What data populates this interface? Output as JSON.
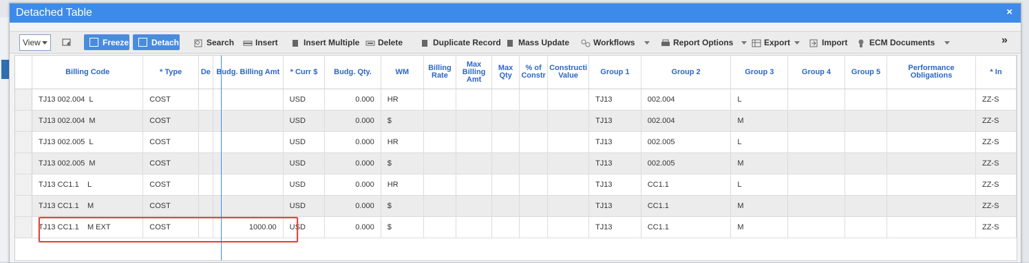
{
  "window": {
    "title": "Detached Table",
    "close_glyph": "×"
  },
  "toolbar": {
    "view_label": "View",
    "freeze_label": "Freeze",
    "detach_label": "Detach",
    "search_label": "Search",
    "insert_label": "Insert",
    "insert_multiple_label": "Insert Multiple",
    "delete_label": "Delete",
    "duplicate_label": "Duplicate Record",
    "mass_update_label": "Mass Update",
    "workflows_label": "Workflows",
    "report_options_label": "Report Options",
    "export_label": "Export",
    "import_label": "Import",
    "ecm_label": "ECM Documents",
    "more_glyph": "»"
  },
  "table": {
    "columns": [
      "Billing Code",
      "* Type",
      "De",
      "Budg. Billing Amt",
      "* Curr $",
      "Budg. Qty.",
      "WM",
      "Billing Rate",
      "Max Billing Amt",
      "Max Qty",
      "% of Constr",
      "Constructi Value",
      "Group 1",
      "Group 2",
      "Group 3",
      "Group 4",
      "Group 5",
      "Performance Obligations",
      "* In"
    ],
    "rows": [
      {
        "billing_code": "TJ13 002.004  L",
        "type": "COST",
        "amt": "",
        "curr": "USD",
        "qty": "0.000",
        "wm": "HR",
        "g1": "TJ13",
        "g2": "002.004",
        "g3": "L",
        "in": "ZZ-S"
      },
      {
        "billing_code": "TJ13 002.004  M",
        "type": "COST",
        "amt": "",
        "curr": "USD",
        "qty": "0.000",
        "wm": "$",
        "g1": "TJ13",
        "g2": "002.004",
        "g3": "M",
        "in": "ZZ-S"
      },
      {
        "billing_code": "TJ13 002.005  L",
        "type": "COST",
        "amt": "",
        "curr": "USD",
        "qty": "0.000",
        "wm": "HR",
        "g1": "TJ13",
        "g2": "002.005",
        "g3": "L",
        "in": "ZZ-S"
      },
      {
        "billing_code": "TJ13 002.005  M",
        "type": "COST",
        "amt": "",
        "curr": "USD",
        "qty": "0.000",
        "wm": "$",
        "g1": "TJ13",
        "g2": "002.005",
        "g3": "M",
        "in": "ZZ-S"
      },
      {
        "billing_code": "TJ13 CC1.1    L",
        "type": "COST",
        "amt": "",
        "curr": "USD",
        "qty": "0.000",
        "wm": "HR",
        "g1": "TJ13",
        "g2": "CC1.1",
        "g3": "L",
        "in": "ZZ-S"
      },
      {
        "billing_code": "TJ13 CC1.1    M",
        "type": "COST",
        "amt": "",
        "curr": "USD",
        "qty": "0.000",
        "wm": "$",
        "g1": "TJ13",
        "g2": "CC1.1",
        "g3": "M",
        "in": "ZZ-S"
      },
      {
        "billing_code": "TJ13 CC1.1    M EXT",
        "type": "COST",
        "amt": "1000.00",
        "curr": "USD",
        "qty": "0.000",
        "wm": "$",
        "g1": "TJ13",
        "g2": "CC1.1",
        "g3": "M",
        "in": "ZZ-S"
      }
    ]
  },
  "colors": {
    "titlebar": "#3d8be8",
    "header_text": "#2c66c4",
    "highlight": "#e0453b"
  }
}
